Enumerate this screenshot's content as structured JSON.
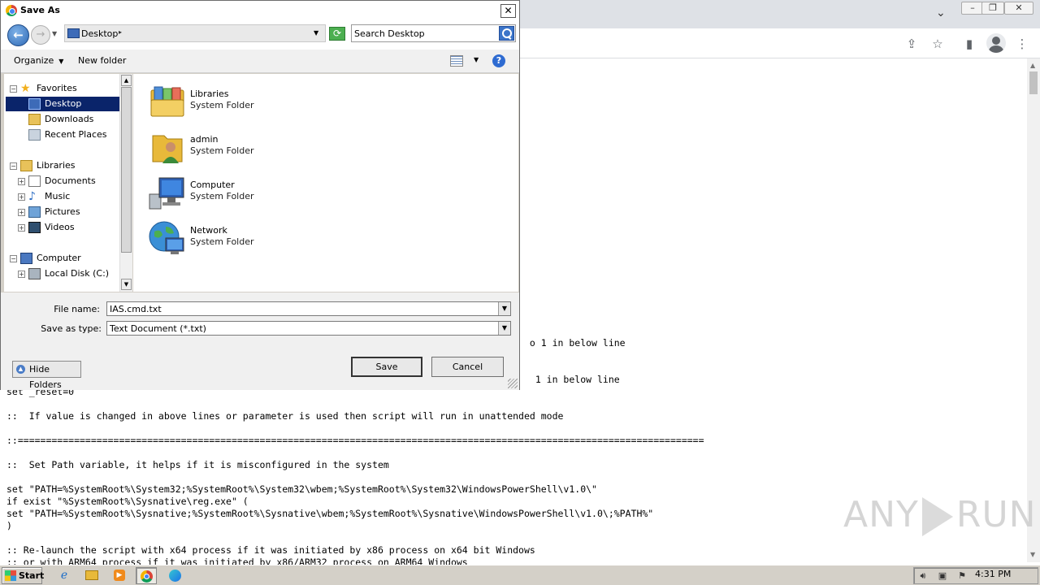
{
  "browser": {
    "controls": {
      "minimize": "–",
      "restore": "❐",
      "close": "✕",
      "tabs_dropdown": "⌄"
    },
    "toolbar_icons": [
      "share-icon",
      "star-icon",
      "sidepanel-icon",
      "profile-icon",
      "menu-icon"
    ]
  },
  "code_lines": [
    "                                                                                             o 1 in below line",
    "",
    "",
    "                                                                                              1 in below line",
    "set _reset=0",
    "",
    "::  If value is changed in above lines or parameter is used then script will run in unattended mode",
    "",
    "::==========================================================================================================================",
    "",
    "::  Set Path variable, it helps if it is misconfigured in the system",
    "",
    "set \"PATH=%SystemRoot%\\System32;%SystemRoot%\\System32\\wbem;%SystemRoot%\\System32\\WindowsPowerShell\\v1.0\\\"",
    "if exist \"%SystemRoot%\\Sysnative\\reg.exe\" (",
    "set \"PATH=%SystemRoot%\\Sysnative;%SystemRoot%\\Sysnative\\wbem;%SystemRoot%\\Sysnative\\WindowsPowerShell\\v1.0\\;%PATH%\"",
    ")",
    "",
    ":: Re-launch the script with x64 process if it was initiated by x86 process on x64 bit Windows",
    ":: or with ARM64 process if it was initiated by x86/ARM32 process on ARM64 Windows"
  ],
  "watermark": {
    "left": "ANY",
    "right": "RUN"
  },
  "dialog": {
    "title": "Save As",
    "close": "✕",
    "address": {
      "location": "Desktop"
    },
    "search": {
      "placeholder": "Search Desktop"
    },
    "commands": {
      "organize": "Organize",
      "new_folder": "New folder",
      "help": "?"
    },
    "nav": {
      "favorites": "Favorites",
      "desktop": "Desktop",
      "downloads": "Downloads",
      "recent_places": "Recent Places",
      "libraries": "Libraries",
      "documents": "Documents",
      "music": "Music",
      "pictures": "Pictures",
      "videos": "Videos",
      "computer": "Computer",
      "local_disk": "Local Disk (C:)"
    },
    "items": [
      {
        "name": "Libraries",
        "type": "System Folder",
        "icon": "libraries-icon"
      },
      {
        "name": "admin",
        "type": "System Folder",
        "icon": "user-folder-icon"
      },
      {
        "name": "Computer",
        "type": "System Folder",
        "icon": "computer-icon"
      },
      {
        "name": "Network",
        "type": "System Folder",
        "icon": "network-icon"
      }
    ],
    "file_name_label": "File name:",
    "file_name_value": "IAS.cmd.txt",
    "save_type_label": "Save as type:",
    "save_type_value": "Text Document (*.txt)",
    "save_button": "Save",
    "cancel_button": "Cancel",
    "hide_folders": "Hide Folders"
  },
  "taskbar": {
    "start": "Start",
    "clock": "4:31 PM",
    "apps": [
      "ie-icon",
      "explorer-icon",
      "media-player-icon",
      "chrome-icon",
      "edge-icon"
    ]
  }
}
